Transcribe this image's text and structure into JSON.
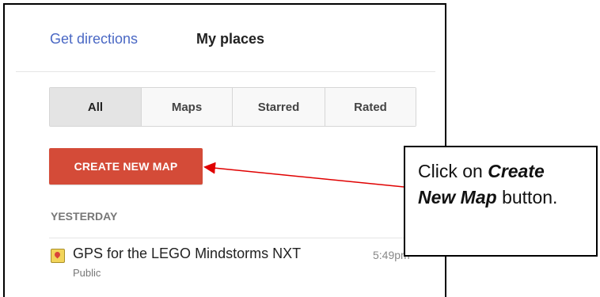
{
  "panel": {
    "tabs": {
      "directions_label": "Get directions",
      "places_label": "My places"
    },
    "filters": [
      {
        "label": "All",
        "active": true
      },
      {
        "label": "Maps",
        "active": false
      },
      {
        "label": "Starred",
        "active": false
      },
      {
        "label": "Rated",
        "active": false
      }
    ],
    "create_button_label": "CREATE NEW MAP",
    "section_label": "YESTERDAY",
    "map_item": {
      "title": "GPS for the LEGO Mindstorms NXT",
      "visibility": "Public",
      "time": "5:49pm",
      "icon": "map-icon"
    }
  },
  "callout": {
    "text_before": "Click on ",
    "emphasis": "Create New Map",
    "text_after": " button."
  },
  "colors": {
    "create_button": "#d44b38",
    "link": "#4a68c4",
    "arrow": "#e00000"
  }
}
